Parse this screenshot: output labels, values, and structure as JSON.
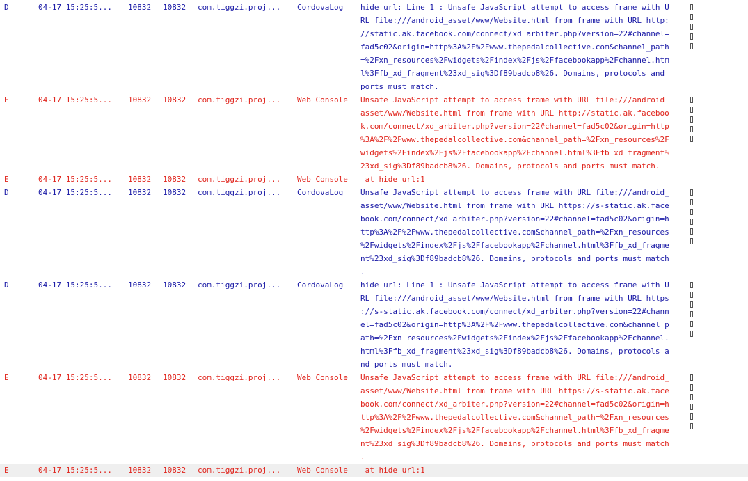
{
  "rows": [
    {
      "level": "D",
      "time": "04-17 15:25:5...",
      "pid": "10832",
      "tid": "10832",
      "app": "com.tiggzi.proj...",
      "tag": "CordovaLog",
      "lines": [
        "hide url: Line 1 : Unsafe JavaScript attempt to access frame with U",
        "RL file:///android_asset/www/Website.html from frame with URL http:",
        "//static.ak.facebook.com/connect/xd_arbiter.php?version=22#channel=",
        "fad5c02&origin=http%3A%2F%2Fwww.thepedalcollective.com&channel_path",
        "=%2Fxn_resources%2Fwidgets%2Findex%2Fjs%2Ffacebookapp%2Fchannel.htm",
        "l%3Ffb_xd_fragment%23xd_sig%3Df89badcb8%26. Domains, protocols and",
        "ports must match."
      ]
    },
    {
      "level": "E",
      "time": "04-17 15:25:5...",
      "pid": "10832",
      "tid": "10832",
      "app": "com.tiggzi.proj...",
      "tag": "Web Console",
      "lines": [
        "Unsafe JavaScript attempt to access frame with URL file:///android_",
        "asset/www/Website.html from frame with URL http://static.ak.faceboo",
        "k.com/connect/xd_arbiter.php?version=22#channel=fad5c02&origin=http",
        "%3A%2F%2Fwww.thepedalcollective.com&channel_path=%2Fxn_resources%2F",
        "widgets%2Findex%2Fjs%2Ffacebookapp%2Fchannel.html%3Ffb_xd_fragment%",
        "23xd_sig%3Df89badcb8%26. Domains, protocols and ports must match."
      ]
    },
    {
      "level": "E",
      "time": "04-17 15:25:5...",
      "pid": "10832",
      "tid": "10832",
      "app": "com.tiggzi.proj...",
      "tag": "Web Console",
      "lines": [
        " at hide url:1"
      ]
    },
    {
      "level": "D",
      "time": "04-17 15:25:5...",
      "pid": "10832",
      "tid": "10832",
      "app": "com.tiggzi.proj...",
      "tag": "CordovaLog",
      "lines": [
        "Unsafe JavaScript attempt to access frame with URL file:///android_",
        "asset/www/Website.html from frame with URL https://s-static.ak.face",
        "book.com/connect/xd_arbiter.php?version=22#channel=fad5c02&origin=h",
        "ttp%3A%2F%2Fwww.thepedalcollective.com&channel_path=%2Fxn_resources",
        "%2Fwidgets%2Findex%2Fjs%2Ffacebookapp%2Fchannel.html%3Ffb_xd_fragme",
        "nt%23xd_sig%3Df89badcb8%26. Domains, protocols and ports must match",
        "."
      ]
    },
    {
      "level": "D",
      "time": "04-17 15:25:5...",
      "pid": "10832",
      "tid": "10832",
      "app": "com.tiggzi.proj...",
      "tag": "CordovaLog",
      "lines": [
        "hide url: Line 1 : Unsafe JavaScript attempt to access frame with U",
        "RL file:///android_asset/www/Website.html from frame with URL https",
        "://s-static.ak.facebook.com/connect/xd_arbiter.php?version=22#chann",
        "el=fad5c02&origin=http%3A%2F%2Fwww.thepedalcollective.com&channel_p",
        "ath=%2Fxn_resources%2Fwidgets%2Findex%2Fjs%2Ffacebookapp%2Fchannel.",
        "html%3Ffb_xd_fragment%23xd_sig%3Df89badcb8%26. Domains, protocols a",
        "nd ports must match."
      ]
    },
    {
      "level": "E",
      "time": "04-17 15:25:5...",
      "pid": "10832",
      "tid": "10832",
      "app": "com.tiggzi.proj...",
      "tag": "Web Console",
      "lines": [
        "Unsafe JavaScript attempt to access frame with URL file:///android_",
        "asset/www/Website.html from frame with URL https://s-static.ak.face",
        "book.com/connect/xd_arbiter.php?version=22#channel=fad5c02&origin=h",
        "ttp%3A%2F%2Fwww.thepedalcollective.com&channel_path=%2Fxn_resources",
        "%2Fwidgets%2Findex%2Fjs%2Ffacebookapp%2Fchannel.html%3Ffb_xd_fragme",
        "nt%23xd_sig%3Df89badcb8%26. Domains, protocols and ports must match",
        "."
      ]
    },
    {
      "level": "E",
      "time": "04-17 15:25:5...",
      "pid": "10832",
      "tid": "10832",
      "app": "com.tiggzi.proj...",
      "tag": "Web Console",
      "lines": [
        " at hide url:1"
      ]
    }
  ],
  "colors": {
    "debug": "#1a1aa6",
    "error": "#e0251d",
    "background": "#ffffff",
    "selected_row": "#efefef"
  }
}
